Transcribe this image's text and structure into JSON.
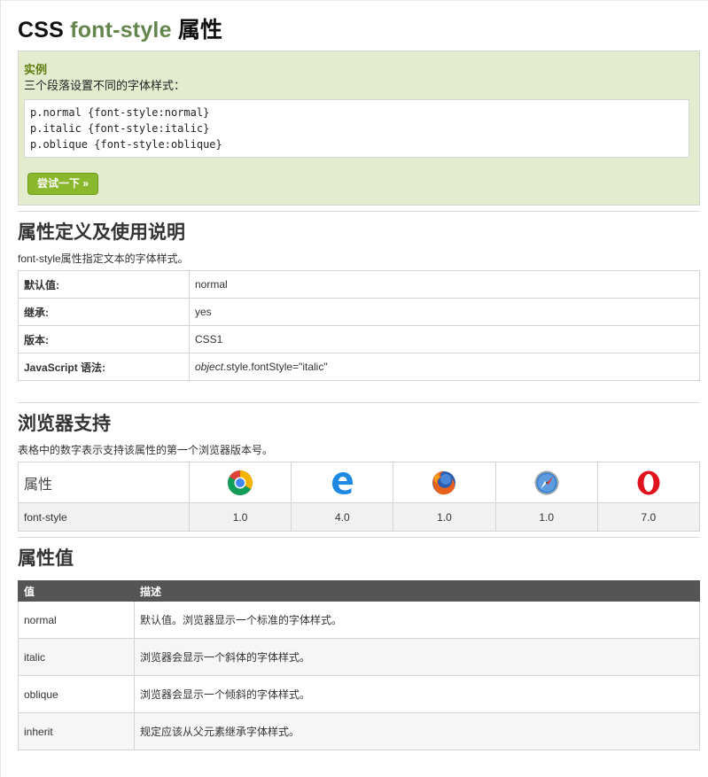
{
  "title": {
    "prefix": "CSS",
    "property": "font-style",
    "suffix": "属性"
  },
  "example": {
    "label": "实例",
    "description": "三个段落设置不同的字体样式：",
    "code_lines": [
      "p.normal {font-style:normal}",
      "p.italic {font-style:italic}",
      "p.oblique {font-style:oblique}"
    ],
    "try_button": "尝试一下 »"
  },
  "definition": {
    "heading": "属性定义及使用说明",
    "intro": "font-style属性指定文本的字体样式。",
    "rows": [
      {
        "key": "默认值:",
        "value": "normal"
      },
      {
        "key": "继承:",
        "value": "yes"
      },
      {
        "key": "版本:",
        "value": "CSS1"
      },
      {
        "key": "JavaScript 语法:",
        "value_italic": "object",
        "value_rest": ".style.fontStyle=\"italic\""
      }
    ]
  },
  "support": {
    "heading": "浏览器支持",
    "intro": "表格中的数字表示支持该属性的第一个浏览器版本号。",
    "header_label": "属性",
    "browsers": [
      {
        "icon": "chrome-icon",
        "name": "chrome"
      },
      {
        "icon": "edge-icon",
        "name": "edge"
      },
      {
        "icon": "firefox-icon",
        "name": "firefox"
      },
      {
        "icon": "safari-icon",
        "name": "safari"
      },
      {
        "icon": "opera-icon",
        "name": "opera"
      }
    ],
    "row_label": "font-style",
    "versions": [
      "1.0",
      "4.0",
      "1.0",
      "1.0",
      "7.0"
    ]
  },
  "values": {
    "heading": "属性值",
    "col_value": "值",
    "col_desc": "描述",
    "rows": [
      {
        "value": "normal",
        "desc": "默认值。浏览器显示一个标准的字体样式。"
      },
      {
        "value": "italic",
        "desc": "浏览器会显示一个斜体的字体样式。"
      },
      {
        "value": "oblique",
        "desc": "浏览器会显示一个倾斜的字体样式。"
      },
      {
        "value": "inherit",
        "desc": "规定应该从父元素继承字体样式。"
      }
    ]
  },
  "colors": {
    "accent_green": "#64854c",
    "example_bg": "#e4eccf",
    "button_green": "#8ab82d",
    "table_header": "#555555"
  }
}
